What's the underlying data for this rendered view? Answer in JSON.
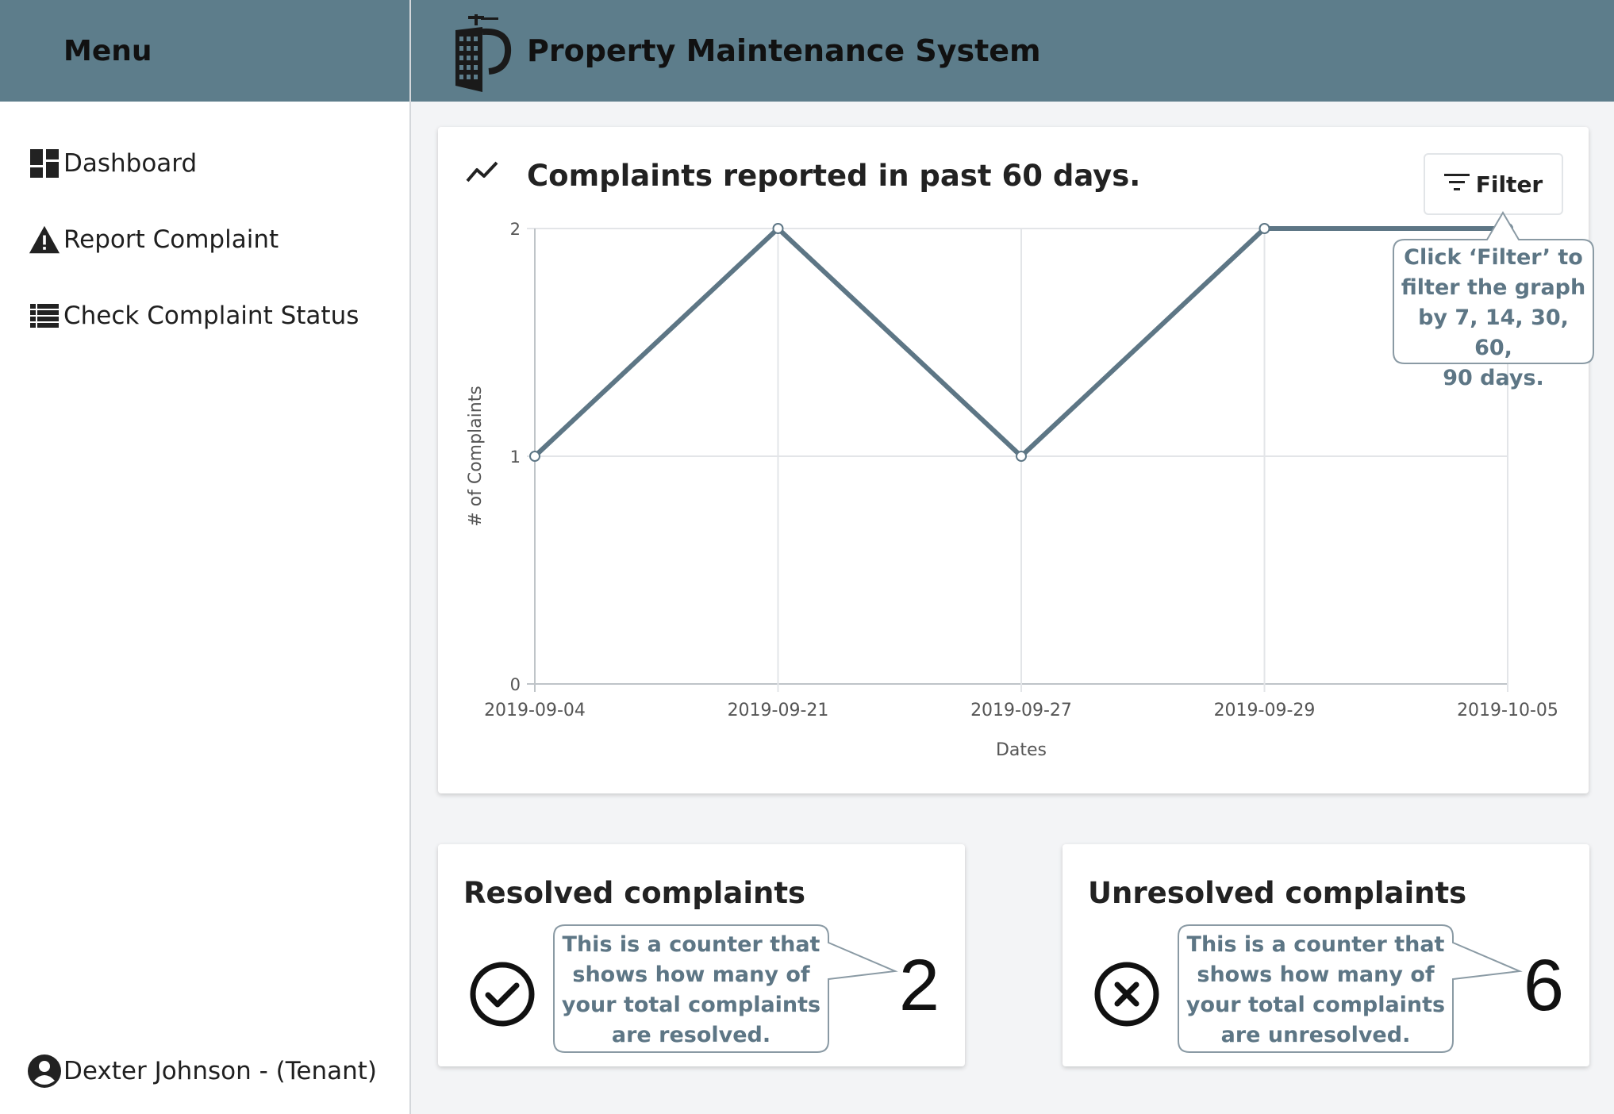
{
  "sidebar": {
    "title": "Menu",
    "items": [
      {
        "label": "Dashboard",
        "icon": "dashboard-icon"
      },
      {
        "label": "Report Complaint",
        "icon": "warning-icon"
      },
      {
        "label": "Check Complaint Status",
        "icon": "list-icon"
      }
    ],
    "user": {
      "label": "Dexter Johnson - (Tenant)",
      "icon": "account-circle-icon"
    }
  },
  "header": {
    "title": "Property Maintenance System",
    "logo": "building-logo-icon"
  },
  "chart_card": {
    "title": "Complaints reported in past 60 days.",
    "filter_label": "Filter",
    "hint": [
      "Click ‘Filter’ to",
      "filter the graph",
      "by 7, 14, 30, 60,",
      "90 days."
    ]
  },
  "chart_data": {
    "type": "line",
    "x": [
      "2019-09-04",
      "2019-09-21",
      "2019-09-27",
      "2019-09-29",
      "2019-10-05"
    ],
    "values": [
      1,
      2,
      1,
      2,
      2
    ],
    "xlabel": "Dates",
    "ylabel": "# of Complaints",
    "ylim": [
      0,
      2
    ],
    "yticks": [
      0,
      1,
      2
    ],
    "grid": true,
    "line_color": "#5d7685"
  },
  "stats": {
    "resolved": {
      "title": "Resolved complaints",
      "count": "2",
      "hint": "This is a counter that shows how many of your total complaints are resolved.",
      "icon": "check-circle-icon"
    },
    "unresolved": {
      "title": "Unresolved complaints",
      "count": "6",
      "hint": "This is a counter that shows how many of your total complaints are unresolved.",
      "icon": "cancel-circle-icon"
    }
  },
  "colors": {
    "header": "#5d7d8b",
    "accent_text": "#5d7685",
    "background": "#f3f4f6"
  }
}
